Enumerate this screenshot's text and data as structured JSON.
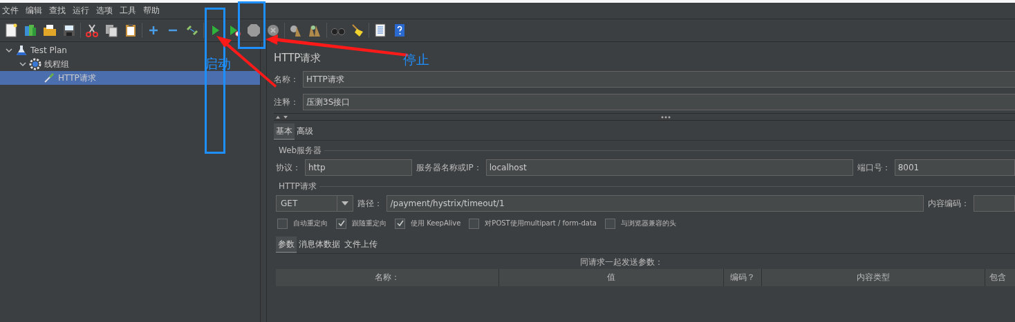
{
  "menu": [
    "文件",
    "编辑",
    "查找",
    "运行",
    "选项",
    "工具",
    "帮助"
  ],
  "tree": [
    {
      "label": "Test Plan",
      "kind": "plan",
      "expanded": true,
      "selected": false,
      "children": [
        {
          "label": "线程组",
          "kind": "group",
          "expanded": true,
          "selected": false,
          "children": [
            {
              "label": "HTTP请求",
              "kind": "sampler",
              "selected": true
            }
          ]
        }
      ]
    }
  ],
  "panel": {
    "title": "HTTP请求",
    "name_field": {
      "label": "名称：",
      "value": "HTTP请求"
    },
    "comment_field": {
      "label": "注释：",
      "value": "压测3S接口"
    },
    "tabs": [
      {
        "label": "基本",
        "selected": true
      },
      {
        "label": "高级",
        "selected": false
      }
    ],
    "web_server": {
      "title": "Web服务器",
      "fields": [
        {
          "label": "协议：",
          "value": "http"
        },
        {
          "label": "服务器名称或IP：",
          "value": "localhost"
        },
        {
          "label": "端口号：",
          "value": "8001"
        }
      ]
    },
    "http_request": {
      "title": "HTTP请求",
      "method": "GET",
      "path_label": "路径：",
      "path": "/payment/hystrix/timeout/1",
      "encoding_label": "内容编码：",
      "options": [
        {
          "label": "自动重定向",
          "checked": false
        },
        {
          "label": "跟随重定向",
          "checked": true
        },
        {
          "label": "使用 KeepAlive",
          "checked": true
        },
        {
          "label": "对POST使用multipart / form-data",
          "checked": false
        },
        {
          "label": "与浏览器兼容的头",
          "checked": false
        }
      ]
    },
    "param_tabs": [
      {
        "label": "参数",
        "selected": true
      },
      {
        "label": "消息体数据",
        "selected": false
      },
      {
        "label": "文件上传",
        "selected": false
      }
    ],
    "params_caption": "同请求一起发送参数：",
    "columns": [
      "名称：",
      "值",
      "编码？",
      "内容类型",
      "包含"
    ]
  },
  "annotations": [
    {
      "label": "启动"
    },
    {
      "label": "停止"
    }
  ]
}
